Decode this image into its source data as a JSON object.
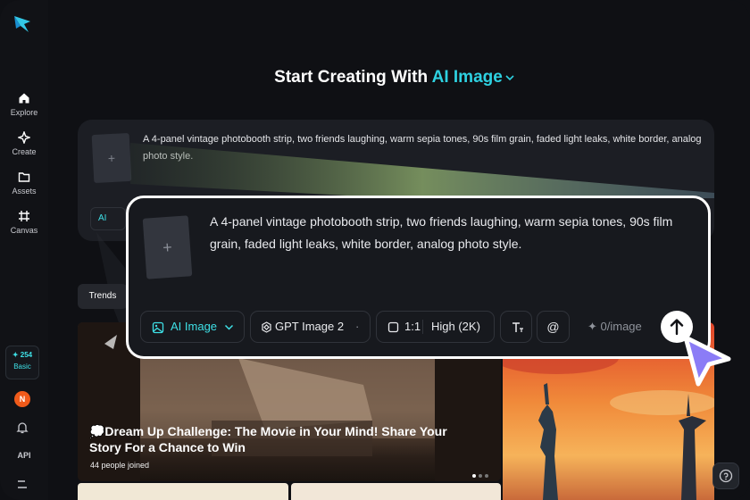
{
  "sidebar": {
    "items": [
      {
        "label": "Explore",
        "icon": "home-icon"
      },
      {
        "label": "Create",
        "icon": "sparkle-icon"
      },
      {
        "label": "Assets",
        "icon": "folder-icon"
      },
      {
        "label": "Canvas",
        "icon": "canvas-icon"
      }
    ],
    "credits": {
      "amount": "✦ 254",
      "plan": "Basic"
    },
    "avatar_initial": "N",
    "api_label": "API"
  },
  "heading": {
    "prefix": "Start Creating With",
    "mode": "AI Image"
  },
  "back_card": {
    "prompt": "A 4-panel vintage photobooth strip, two friends laughing, warm sepia tones, 90s film grain, faded light leaks, white border, analog photo style.",
    "chip_label": "AI"
  },
  "trends_tab": "Trends",
  "banner": {
    "title": "💭Dream Up Challenge: The Movie in Your Mind! Share Your Story For a Chance to Win",
    "subtitle": "44 people joined"
  },
  "main_card": {
    "prompt": "A 4-panel vintage photobooth strip, two friends laughing, warm sepia tones, 90s film grain, faded light leaks, white border, analog photo style.",
    "mode_label": "AI Image",
    "model_label": "GPT Image 2",
    "ratio_label": "1:1",
    "quality_label": "High (2K)",
    "mention_symbol": "@",
    "cost_label": "✦ 0/image"
  },
  "colors": {
    "accent": "#2ed1e1",
    "background": "#0f1014",
    "card": "#17191e",
    "cursor": "#8b7cf6"
  }
}
